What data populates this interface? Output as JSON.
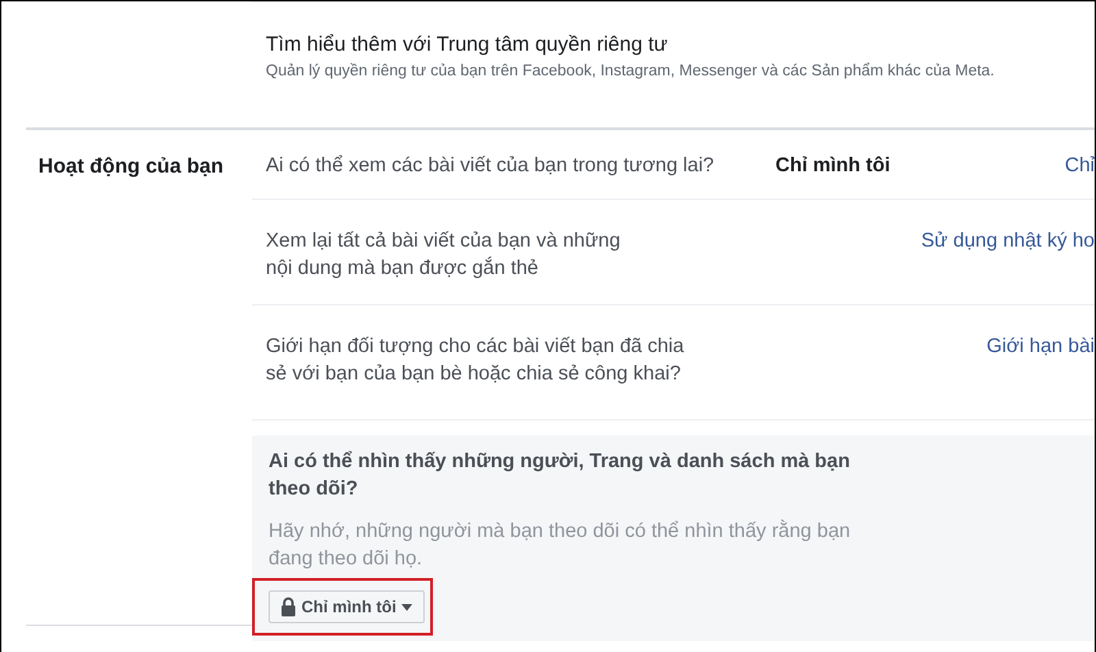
{
  "privacy_center": {
    "title": "Tìm hiểu thêm với Trung tâm quyền riêng tư",
    "subtitle": "Quản lý quyền riêng tư của bạn trên Facebook, Instagram, Messenger và các Sản phẩm khác của Meta."
  },
  "section": {
    "label": "Hoạt động của bạn",
    "rows": [
      {
        "kind": "setting",
        "question": "Ai có thể xem các bài viết của bạn trong tương lai?",
        "value": "Chỉ mình tôi",
        "link": "Chỉ"
      },
      {
        "kind": "setting",
        "question": "Xem lại tất cả bài viết của bạn và những\nnội dung mà bạn được gắn thẻ",
        "link": "Sử dụng nhật ký ho"
      },
      {
        "kind": "setting",
        "question": "Giới hạn đối tượng cho các bài viết bạn đã chia\nsẻ với bạn của bạn bè hoặc chia sẻ công khai?",
        "link": "Giới hạn bài"
      },
      {
        "kind": "expanded",
        "question": "Ai có thể nhìn thấy những người, Trang và danh sách mà bạn\ntheo dõi?",
        "note": "Hãy nhớ, những người mà bạn theo dõi có thể nhìn thấy rằng bạn\nđang theo dõi họ.",
        "audience": {
          "label": "Chỉ mình tôi",
          "highlighted": true
        }
      }
    ]
  }
}
